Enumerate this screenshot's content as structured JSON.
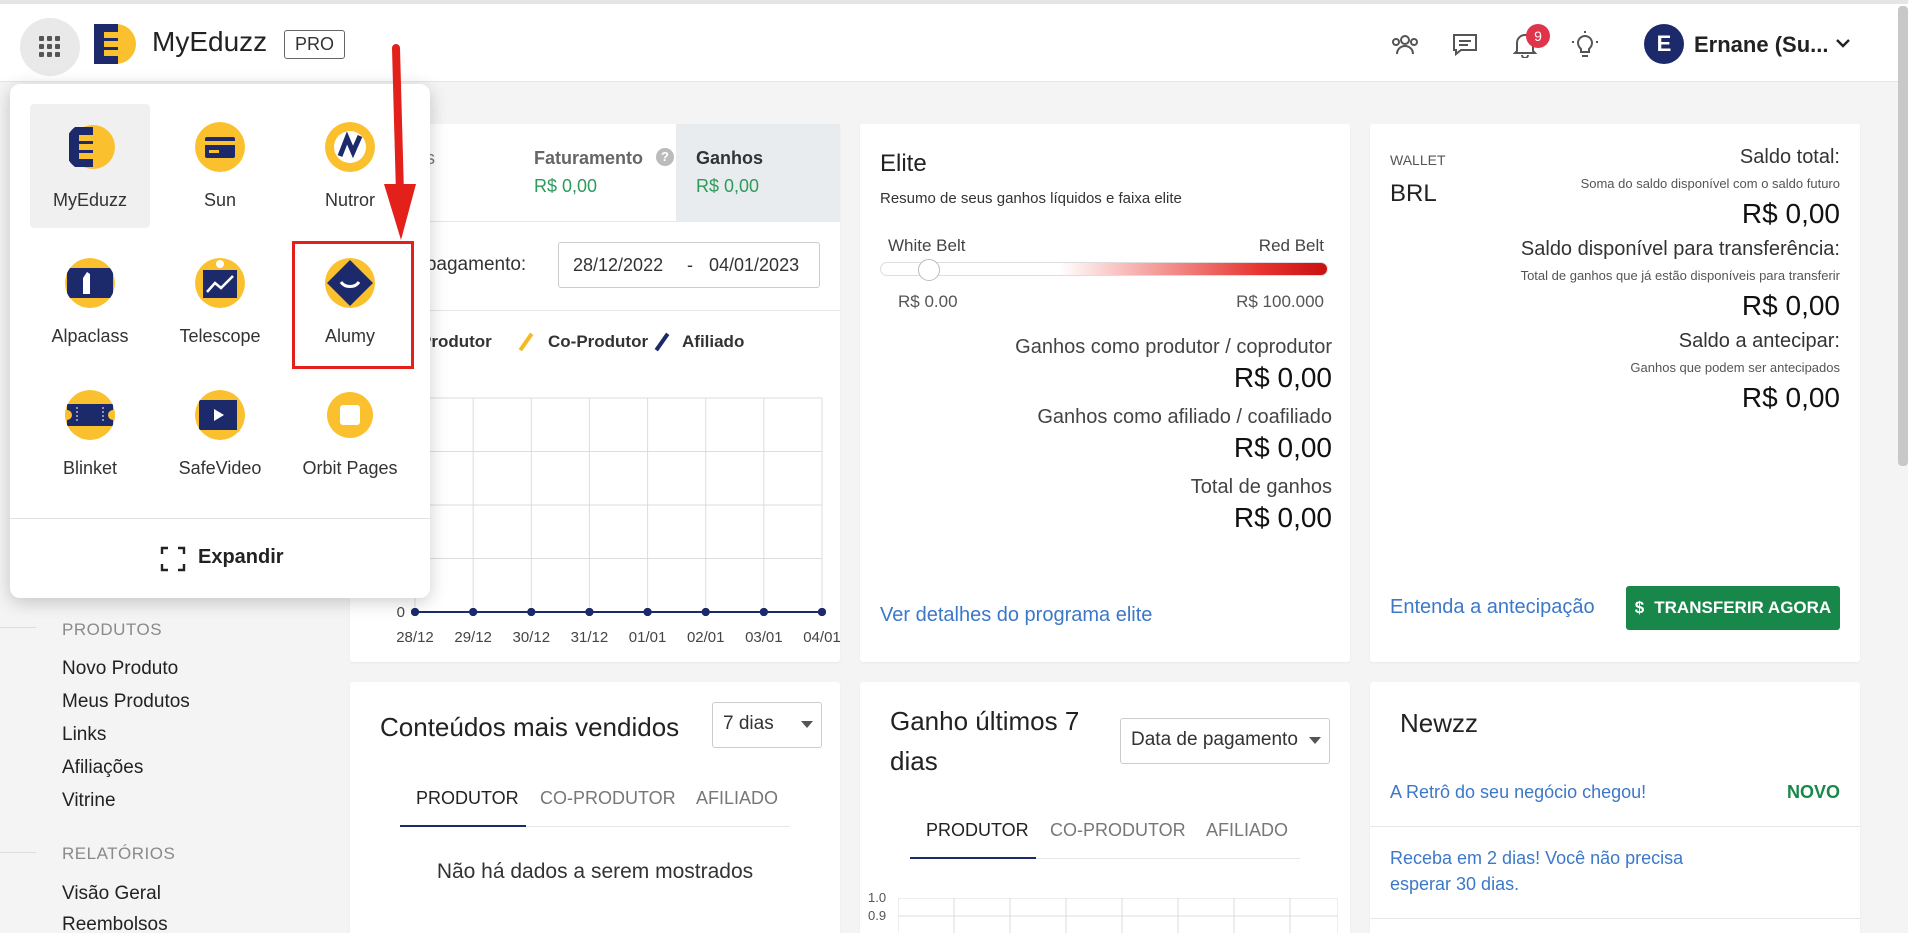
{
  "header": {
    "brand": "MyEduzz",
    "badge": "PRO",
    "notifications_count": "9",
    "user_initial": "E",
    "user_name": "Ernane (Su..."
  },
  "app_menu": {
    "apps": [
      {
        "label": "MyEduzz",
        "icon": "myeduzz-icon",
        "active": true
      },
      {
        "label": "Sun",
        "icon": "sun-card-icon"
      },
      {
        "label": "Nutror",
        "icon": "nutror-icon"
      },
      {
        "label": "Alpaclass",
        "icon": "alpaclass-icon"
      },
      {
        "label": "Telescope",
        "icon": "telescope-icon"
      },
      {
        "label": "Alumy",
        "icon": "alumy-icon"
      },
      {
        "label": "Blinket",
        "icon": "blinket-icon"
      },
      {
        "label": "SafeVideo",
        "icon": "safevideo-icon"
      },
      {
        "label": "Orbit Pages",
        "icon": "orbit-pages-icon"
      }
    ],
    "expand_label": "Expandir"
  },
  "sidebar": {
    "produtos_title": "PRODUTOS",
    "produtos": [
      "Novo Produto",
      "Meus Produtos",
      "Links",
      "Afiliações",
      "Vitrine"
    ],
    "relatorios_title": "RELATÓRIOS",
    "relatorios": [
      "Visão Geral",
      "Reembolsos"
    ]
  },
  "summary": {
    "tab_partial": "s",
    "faturamento_label": "Faturamento",
    "faturamento_value": "R$ 0,00",
    "ganhos_label": "Ganhos",
    "ganhos_value": "R$ 0,00",
    "date_label": "e pagamento:",
    "date_from": "28/12/2022",
    "date_sep": "-",
    "date_to": "04/01/2023",
    "legend": [
      "Produtor",
      "Co-Produtor",
      "Afiliado"
    ],
    "legend_colors": [
      "#f5b921",
      "#f5b921",
      "#1c2a6b"
    ]
  },
  "chart_data": {
    "type": "line",
    "categories": [
      "28/12",
      "29/12",
      "30/12",
      "31/12",
      "01/01",
      "02/01",
      "03/01",
      "04/01"
    ],
    "series": [
      {
        "name": "Produtor",
        "values": [
          0,
          0,
          0,
          0,
          0,
          0,
          0,
          0
        ]
      },
      {
        "name": "Co-Produtor",
        "values": [
          0,
          0,
          0,
          0,
          0,
          0,
          0,
          0
        ]
      },
      {
        "name": "Afiliado",
        "values": [
          0,
          0,
          0,
          0,
          0,
          0,
          0,
          0
        ]
      }
    ],
    "y_tick_visible": "0",
    "grid": true
  },
  "elite": {
    "title": "Elite",
    "subtitle": "Resumo de seus ganhos líquidos e faixa elite",
    "belt_start": "White Belt",
    "belt_end": "Red Belt",
    "min_value": "R$ 0.00",
    "max_value": "R$ 100.000",
    "progress": 0,
    "producer_label": "Ganhos como produtor / coprodutor",
    "producer_value": "R$ 0,00",
    "affiliate_label": "Ganhos como afiliado / coafiliado",
    "affiliate_value": "R$ 0,00",
    "total_label": "Total de ganhos",
    "total_value": "R$ 0,00",
    "details_link": "Ver detalhes do programa elite"
  },
  "wallet": {
    "tag": "WALLET",
    "currency": "BRL",
    "total_label": "Saldo total:",
    "total_sub": "Soma do saldo disponível com o saldo futuro",
    "total_value": "R$ 0,00",
    "available_label": "Saldo disponível para transferência:",
    "available_sub": "Total de ganhos que já estão disponíveis para transferir",
    "available_value": "R$ 0,00",
    "anticipate_label": "Saldo a antecipar:",
    "anticipate_sub": "Ganhos que podem ser antecipados",
    "anticipate_value": "R$ 0,00",
    "learn_link": "Entenda a antecipação",
    "transfer_button": "TRANSFERIR AGORA",
    "transfer_icon": "$"
  },
  "top_content": {
    "title": "Conteúdos mais vendidos",
    "period": "7 dias",
    "tabs": [
      "PRODUTOR",
      "CO-PRODUTOR",
      "AFILIADO"
    ],
    "empty": "Não há dados a serem mostrados"
  },
  "gains7": {
    "title_line1": "Ganho últimos 7",
    "title_line2": "dias",
    "select": "Data de pagamento",
    "tabs": [
      "PRODUTOR",
      "CO-PRODUTOR",
      "AFILIADO"
    ],
    "y_ticks": [
      "1.0",
      "0.9"
    ]
  },
  "newzz": {
    "title": "Newzz",
    "item1": "A Retrô do seu negócio chegou!",
    "item1_badge": "NOVO",
    "item2_line1": "Receba em 2 dias! Você não precisa",
    "item2_line2": "esperar 30 dias."
  },
  "colors": {
    "brand_navy": "#1c2a6b",
    "brand_yellow": "#fbc02d",
    "green": "#17884a",
    "highlight_red": "#e32019",
    "link_blue": "#3c78c8"
  }
}
